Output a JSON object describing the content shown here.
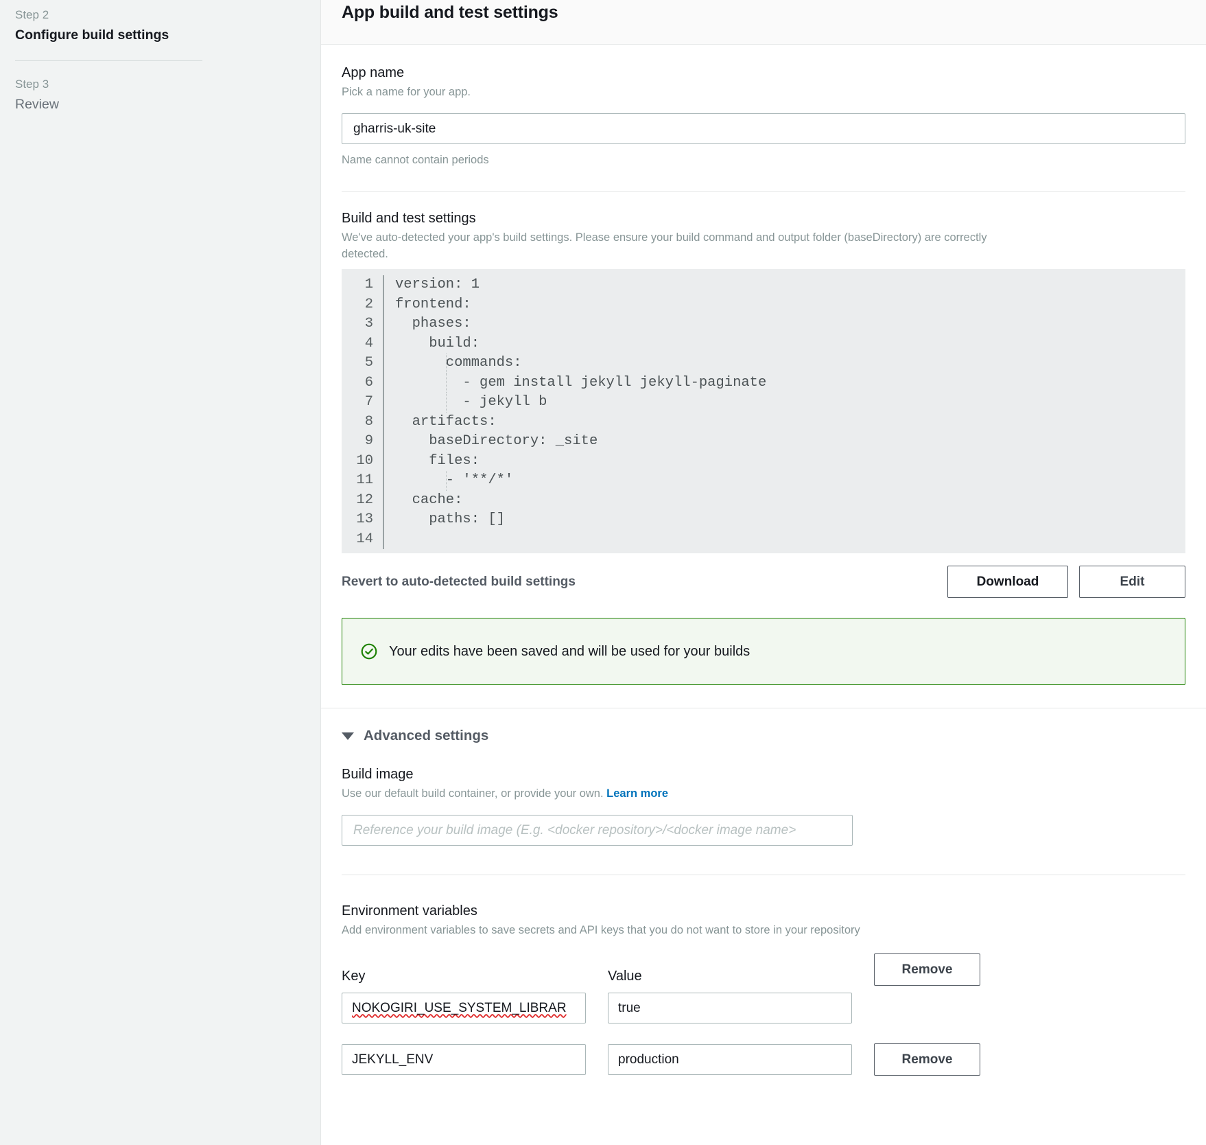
{
  "wizard": {
    "steps": [
      {
        "label": "Step 2",
        "title": "Configure build settings",
        "active": true
      },
      {
        "label": "Step 3",
        "title": "Review",
        "active": false
      }
    ]
  },
  "panel": {
    "title": "App build and test settings"
  },
  "app_name": {
    "label": "App name",
    "description": "Pick a name for your app.",
    "value": "gharris-uk-site",
    "placeholder": "",
    "hint": "Name cannot contain periods"
  },
  "build_settings": {
    "label": "Build and test settings",
    "description": "We've auto-detected your app's build settings. Please ensure your build command and output folder (baseDirectory) are correctly detected.",
    "code_lines": [
      {
        "n": "1",
        "text": "version: 1"
      },
      {
        "n": "2",
        "text": "frontend:"
      },
      {
        "n": "3",
        "text": "  phases:"
      },
      {
        "n": "4",
        "text": "    build:"
      },
      {
        "n": "5",
        "text": "      commands:"
      },
      {
        "n": "6",
        "text": "        - gem install jekyll jekyll-paginate"
      },
      {
        "n": "7",
        "text": "        - jekyll b"
      },
      {
        "n": "8",
        "text": "  artifacts:"
      },
      {
        "n": "9",
        "text": "    baseDirectory: _site"
      },
      {
        "n": "10",
        "text": "    files:"
      },
      {
        "n": "11",
        "text": "      - '**/*'"
      },
      {
        "n": "12",
        "text": "  cache:"
      },
      {
        "n": "13",
        "text": "    paths: []"
      },
      {
        "n": "14",
        "text": ""
      }
    ],
    "revert_label": "Revert to auto-detected build settings",
    "download_label": "Download",
    "edit_label": "Edit"
  },
  "alert": {
    "icon": "check-circle-icon",
    "message": "Your edits have been saved and will be used for your builds",
    "border_color": "#1d8102",
    "background_color": "#f2f8f0"
  },
  "advanced": {
    "title": "Advanced settings",
    "expanded": true,
    "build_image": {
      "label": "Build image",
      "description": "Use our default build container, or provide your own.",
      "link_label": "Learn more",
      "link_color": "#0073bb",
      "placeholder": "Reference your build image (E.g. <docker repository>/<docker image name>",
      "value": ""
    },
    "env": {
      "label": "Environment variables",
      "description": "Add environment variables to save secrets and API keys that you do not want to store in your repository",
      "key_column": "Key",
      "value_column": "Value",
      "remove_label": "Remove",
      "rows": [
        {
          "key": "NOKOGIRI_USE_SYSTEM_LIBRAR",
          "value": "true",
          "remove_label": "Remove",
          "misspelled": true
        },
        {
          "key": "JEKYLL_ENV",
          "value": "production",
          "remove_label": "Remove",
          "misspelled": false
        }
      ]
    }
  }
}
